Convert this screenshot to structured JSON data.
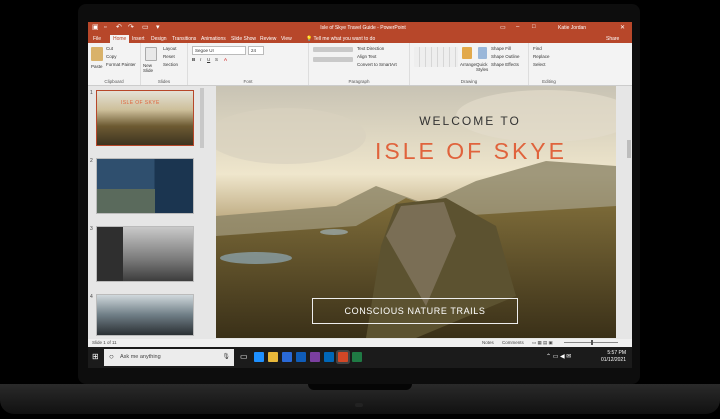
{
  "app": {
    "title": "Isle of Skye Travel Guide - PowerPoint",
    "user": "Katie Jordan",
    "share_label": "Share",
    "tell_me": "Tell me what you want to do"
  },
  "tabs": [
    "File",
    "Home",
    "Insert",
    "Design",
    "Transitions",
    "Animations",
    "Slide Show",
    "Review",
    "View"
  ],
  "ribbon": {
    "clipboard": {
      "paste": "Paste",
      "cut": "Cut",
      "copy": "Copy",
      "format_painter": "Format Painter",
      "label": "Clipboard"
    },
    "slides": {
      "new_slide": "New Slide",
      "layout": "Layout",
      "reset": "Reset",
      "section": "Section",
      "label": "Slides"
    },
    "font": {
      "font_name": "Segoe UI",
      "font_size": "24",
      "label": "Font"
    },
    "paragraph": {
      "text_direction": "Text Direction",
      "align_text": "Align Text",
      "convert_smartart": "Convert to SmartArt",
      "label": "Paragraph"
    },
    "drawing": {
      "arrange": "Arrange",
      "quick_styles": "Quick Styles",
      "shape_fill": "Shape Fill",
      "shape_outline": "Shape Outline",
      "shape_effects": "Shape Effects",
      "label": "Drawing"
    },
    "editing": {
      "find": "Find",
      "replace": "Replace",
      "select": "Select",
      "label": "Editing"
    }
  },
  "thumbnails": [
    {
      "num": "1",
      "title": "ISLE OF SKYE"
    },
    {
      "num": "2"
    },
    {
      "num": "3"
    },
    {
      "num": "4"
    }
  ],
  "slide": {
    "welcome": "WELCOME TO",
    "title": "ISLE OF SKYE",
    "subtitle": "CONSCIOUS NATURE TRAILS"
  },
  "status": {
    "slide_info": "Slide 1 of 11",
    "notes": "Notes",
    "comments": "Comments"
  },
  "taskbar": {
    "search_placeholder": "Ask me anything",
    "time": "5:57 PM",
    "date": "01/12/2021"
  },
  "colors": {
    "accent": "#b7472a",
    "title_orange": "#e0633c"
  }
}
